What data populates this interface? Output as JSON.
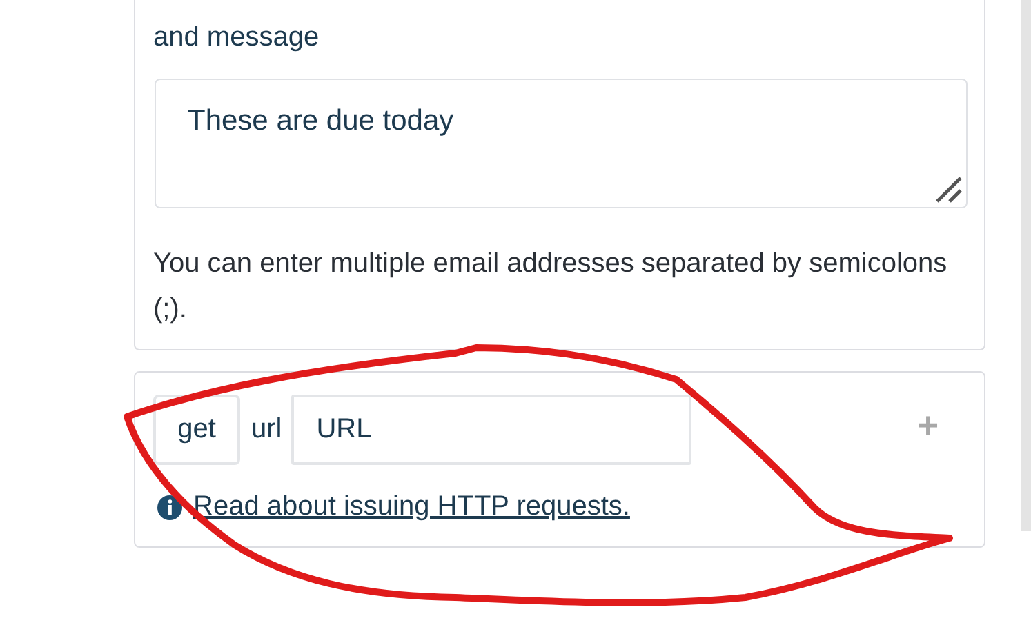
{
  "message_card": {
    "label": "and message",
    "message": {
      "value": "These are due today"
    },
    "help": "You can enter multiple email addresses separated by semicolons (;)."
  },
  "request_card": {
    "method_button": "get",
    "url_label": "url",
    "url_field": {
      "placeholder": "URL"
    },
    "add_button": "+",
    "info_link": "Read about issuing HTTP requests."
  }
}
